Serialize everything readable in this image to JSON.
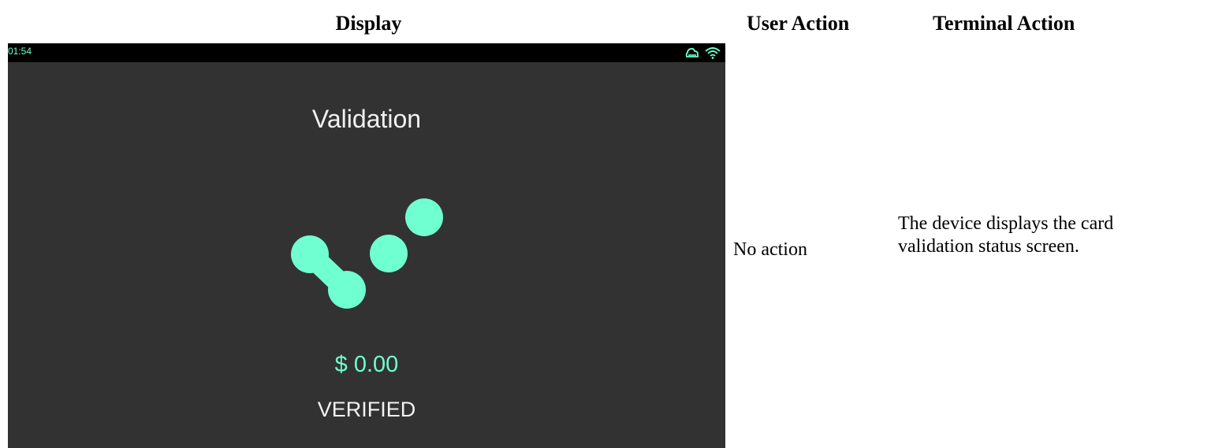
{
  "columns": {
    "display": "Display",
    "user_action": "User Action",
    "terminal_action": "Terminal Action"
  },
  "device": {
    "clock": "01:54",
    "status_icons": [
      "cloud-icon",
      "wifi-icon"
    ],
    "title": "Validation",
    "amount": "$ 0.00",
    "status": "VERIFIED",
    "accent_color": "#6fffd0",
    "background_color": "#323232"
  },
  "row": {
    "user_action": "No action",
    "terminal_action": "The device displays the card validation status screen."
  }
}
